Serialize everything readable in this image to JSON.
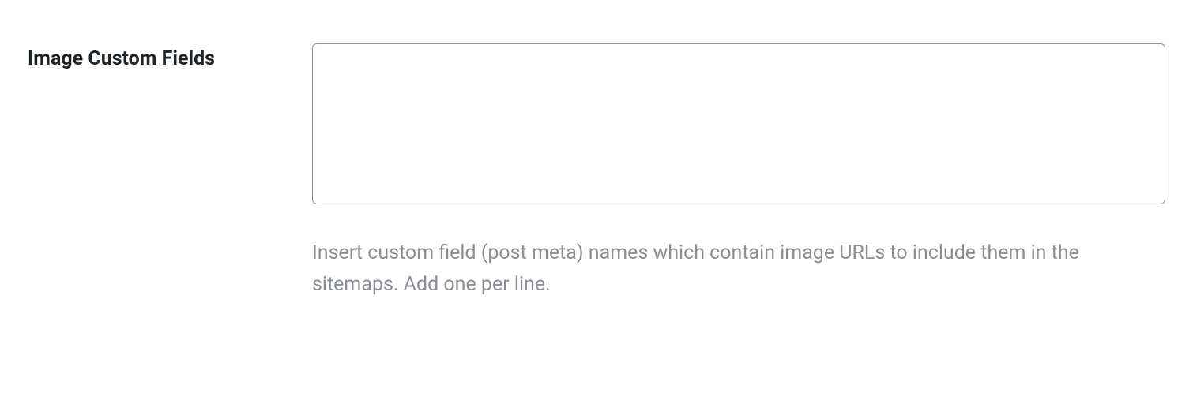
{
  "field": {
    "label": "Image Custom Fields",
    "value": "",
    "description": "Insert custom field (post meta) names which contain image URLs to include them in the sitemaps. Add one per line."
  }
}
